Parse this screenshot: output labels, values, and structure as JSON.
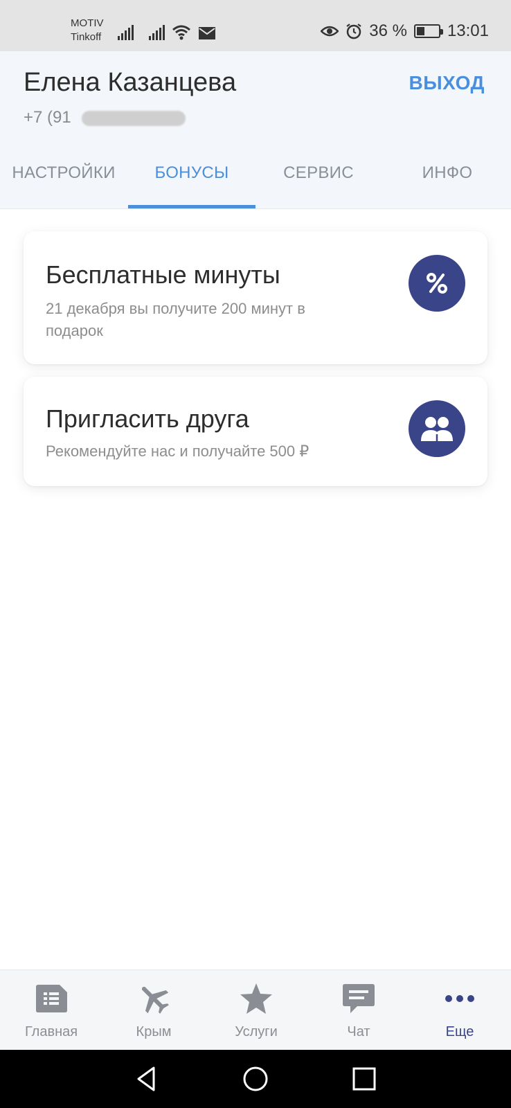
{
  "status_bar": {
    "carrier_1": "MOTIV",
    "carrier_2": "Tinkoff",
    "battery_percent": "36 %",
    "battery_level": 0.36,
    "time": "13:01",
    "icons": [
      "signal-icon",
      "signal-icon",
      "wifi-icon",
      "mail-icon",
      "eye-icon",
      "alarm-icon",
      "battery-icon"
    ]
  },
  "header": {
    "user_name": "Елена Казанцева",
    "phone_visible": "+7 (91",
    "logout_label": "ВЫХОД"
  },
  "tabs": [
    {
      "label": "НАСТРОЙКИ",
      "active": false
    },
    {
      "label": "БОНУСЫ",
      "active": true
    },
    {
      "label": "СЕРВИС",
      "active": false
    },
    {
      "label": "ИНФО",
      "active": false
    }
  ],
  "cards": [
    {
      "title": "Бесплатные минуты",
      "description": "21 декабря вы получите 200 минут в подарок",
      "icon": "percent-icon"
    },
    {
      "title": "Пригласить друга",
      "description": "Рекомендуйте нас и получайте 500 ₽",
      "icon": "friends-icon"
    }
  ],
  "bottom_nav": [
    {
      "label": "Главная",
      "icon": "sim-card-icon",
      "active": false
    },
    {
      "label": "Крым",
      "icon": "airplane-icon",
      "active": false
    },
    {
      "label": "Услуги",
      "icon": "star-icon",
      "active": false
    },
    {
      "label": "Чат",
      "icon": "chat-icon",
      "active": false
    },
    {
      "label": "Еще",
      "icon": "more-icon",
      "active": true
    }
  ],
  "colors": {
    "accent": "#4a8fdb",
    "brand": "#3a4488",
    "header_bg": "#f3f6fa"
  }
}
